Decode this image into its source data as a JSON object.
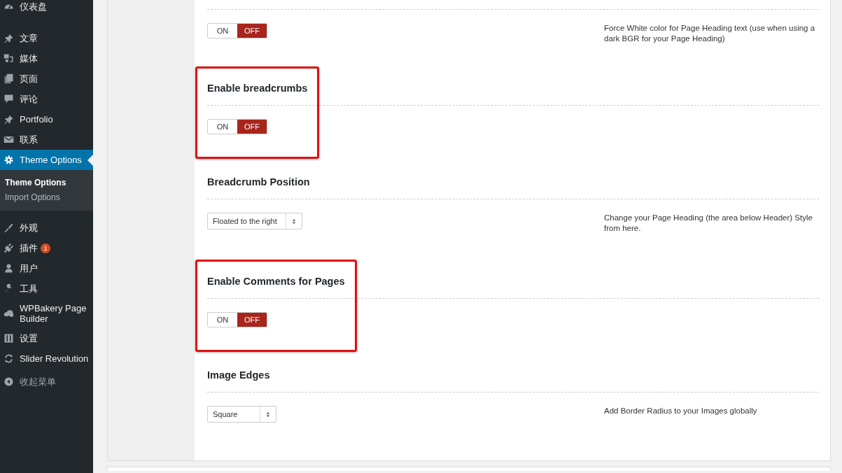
{
  "sidebar": {
    "items": [
      {
        "label": "仪表盘",
        "selected": false
      },
      {
        "label": "文章",
        "selected": false
      },
      {
        "label": "媒体",
        "selected": false
      },
      {
        "label": "页面",
        "selected": false
      },
      {
        "label": "评论",
        "selected": false
      },
      {
        "label": "Portfolio",
        "selected": false
      },
      {
        "label": "联系",
        "selected": false
      },
      {
        "label": "Theme Options",
        "selected": true,
        "children": [
          {
            "label": "Theme Options",
            "selected": true
          },
          {
            "label": "Import Options",
            "selected": false
          }
        ]
      },
      {
        "label": "外观",
        "selected": false
      },
      {
        "label": "插件",
        "selected": false,
        "badge": "1"
      },
      {
        "label": "用户",
        "selected": false
      },
      {
        "label": "工具",
        "selected": false
      },
      {
        "label": "WPBakery Page Builder",
        "selected": false
      },
      {
        "label": "设置",
        "selected": false
      },
      {
        "label": "Slider Revolution",
        "selected": false
      },
      {
        "label": "收起菜单",
        "selected": false
      }
    ]
  },
  "options": [
    {
      "kind": "toggle",
      "on": false,
      "on_label": "ON",
      "off_label": "OFF",
      "description": "Force White color for Page Heading text (use when using a dark BGR for your Page Heading)",
      "highlighted": false
    },
    {
      "kind": "toggle",
      "title": "Enable breadcrumbs",
      "on": false,
      "on_label": "ON",
      "off_label": "OFF",
      "highlighted": true
    },
    {
      "kind": "select",
      "title": "Breadcrumb Position",
      "value": "Floated to the right",
      "description": "Change your Page Heading (the area below Header) Style from here.",
      "highlighted": false
    },
    {
      "kind": "toggle",
      "title": "Enable Comments for Pages",
      "on": false,
      "on_label": "ON",
      "off_label": "OFF",
      "highlighted": true
    },
    {
      "kind": "select",
      "title": "Image Edges",
      "value": "Square",
      "description": "Add Border Radius to your Images globally",
      "highlighted": false
    }
  ]
}
